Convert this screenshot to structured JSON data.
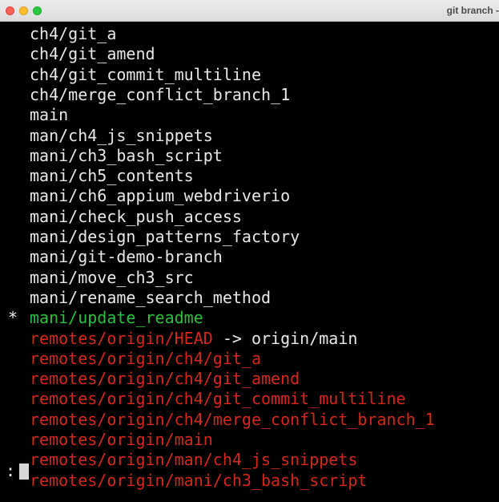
{
  "window": {
    "title": "git branch -"
  },
  "terminal": {
    "lines": [
      {
        "marker": "",
        "text": "ch4/git_a",
        "color": "#e8e8e8"
      },
      {
        "marker": "",
        "text": "ch4/git_amend",
        "color": "#e8e8e8"
      },
      {
        "marker": "",
        "text": "ch4/git_commit_multiline",
        "color": "#e8e8e8"
      },
      {
        "marker": "",
        "text": "ch4/merge_conflict_branch_1",
        "color": "#e8e8e8"
      },
      {
        "marker": "",
        "text": "main",
        "color": "#e8e8e8"
      },
      {
        "marker": "",
        "text": "man/ch4_js_snippets",
        "color": "#e8e8e8"
      },
      {
        "marker": "",
        "text": "mani/ch3_bash_script",
        "color": "#e8e8e8"
      },
      {
        "marker": "",
        "text": "mani/ch5_contents",
        "color": "#e8e8e8"
      },
      {
        "marker": "",
        "text": "mani/ch6_appium_webdriverio",
        "color": "#e8e8e8"
      },
      {
        "marker": "",
        "text": "mani/check_push_access",
        "color": "#e8e8e8"
      },
      {
        "marker": "",
        "text": "mani/design_patterns_factory",
        "color": "#e8e8e8"
      },
      {
        "marker": "",
        "text": "mani/git-demo-branch",
        "color": "#e8e8e8"
      },
      {
        "marker": "",
        "text": "mani/move_ch3_src",
        "color": "#e8e8e8"
      },
      {
        "marker": "",
        "text": "mani/rename_search_method",
        "color": "#e8e8e8"
      },
      {
        "marker": "*",
        "text": "mani/update_readme",
        "color": "#29c03c"
      },
      {
        "marker": "",
        "text": "remotes/origin/HEAD",
        "color": "#d4281c",
        "suffix": " -> origin/main",
        "suffix_color": "#e8e8e8"
      },
      {
        "marker": "",
        "text": "remotes/origin/ch4/git_a",
        "color": "#d4281c"
      },
      {
        "marker": "",
        "text": "remotes/origin/ch4/git_amend",
        "color": "#d4281c"
      },
      {
        "marker": "",
        "text": "remotes/origin/ch4/git_commit_multiline",
        "color": "#d4281c"
      },
      {
        "marker": "",
        "text": "remotes/origin/ch4/merge_conflict_branch_1",
        "color": "#d4281c"
      },
      {
        "marker": "",
        "text": "remotes/origin/main",
        "color": "#d4281c"
      },
      {
        "marker": "",
        "text": "remotes/origin/man/ch4_js_snippets",
        "color": "#d4281c"
      },
      {
        "marker": "",
        "text": "remotes/origin/mani/ch3_bash_script",
        "color": "#d4281c"
      }
    ],
    "prompt": ":"
  },
  "colors": {
    "background": "#000000",
    "default_text": "#e8e8e8",
    "current_branch": "#29c03c",
    "remote_branch": "#d4281c"
  }
}
